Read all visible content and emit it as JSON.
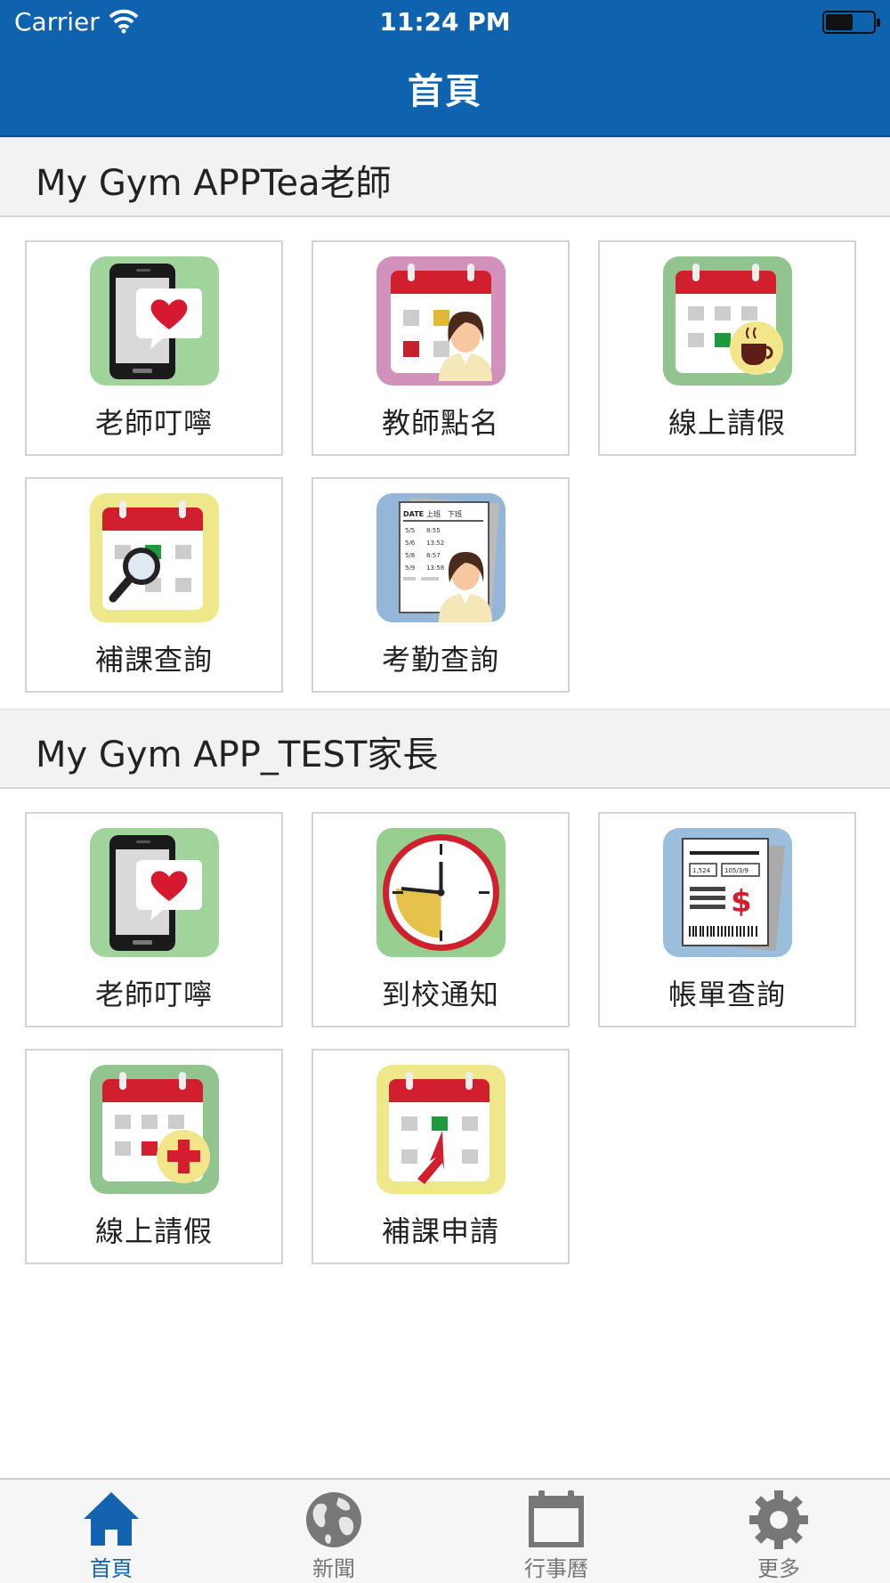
{
  "status_bar": {
    "carrier": "Carrier",
    "time": "11:24 PM"
  },
  "nav": {
    "title": "首頁"
  },
  "sections": [
    {
      "title": "My Gym APPTea老師",
      "tiles": [
        {
          "label": "老師叮嚀",
          "icon": "phone-heart-icon"
        },
        {
          "label": "教師點名",
          "icon": "calendar-teacher-icon"
        },
        {
          "label": "線上請假",
          "icon": "calendar-coffee-icon"
        },
        {
          "label": "補課查詢",
          "icon": "calendar-search-icon"
        },
        {
          "label": "考勤查詢",
          "icon": "attendance-sheet-icon"
        }
      ]
    },
    {
      "title": "My Gym APP_TEST家長",
      "tiles": [
        {
          "label": "老師叮嚀",
          "icon": "phone-heart-icon"
        },
        {
          "label": "到校通知",
          "icon": "clock-icon"
        },
        {
          "label": "帳單查詢",
          "icon": "bill-icon"
        },
        {
          "label": "線上請假",
          "icon": "calendar-medical-icon"
        },
        {
          "label": "補課申請",
          "icon": "calendar-apply-icon"
        }
      ]
    }
  ],
  "attendance_sheet": {
    "header": [
      "DATE",
      "上班",
      "下班"
    ],
    "rows": [
      [
        "5/5",
        "8:55"
      ],
      [
        "5/6",
        "13:52"
      ],
      [
        "5/8",
        "8:57"
      ],
      [
        "5/9",
        "13:58"
      ]
    ]
  },
  "bill_sheet": {
    "fields": [
      "1,524",
      "105/3/9"
    ],
    "symbol": "$"
  },
  "tabbar": {
    "items": [
      {
        "label": "首頁",
        "icon": "home-icon",
        "active": true
      },
      {
        "label": "新聞",
        "icon": "globe-icon",
        "active": false
      },
      {
        "label": "行事曆",
        "icon": "calendar-icon",
        "active": false
      },
      {
        "label": "更多",
        "icon": "gear-icon",
        "active": false
      }
    ]
  },
  "colors": {
    "nav_bar": "#0f62ad",
    "tab_active": "#1463b0",
    "tab_inactive": "#777777",
    "section_bg": "#f2f2f2"
  }
}
